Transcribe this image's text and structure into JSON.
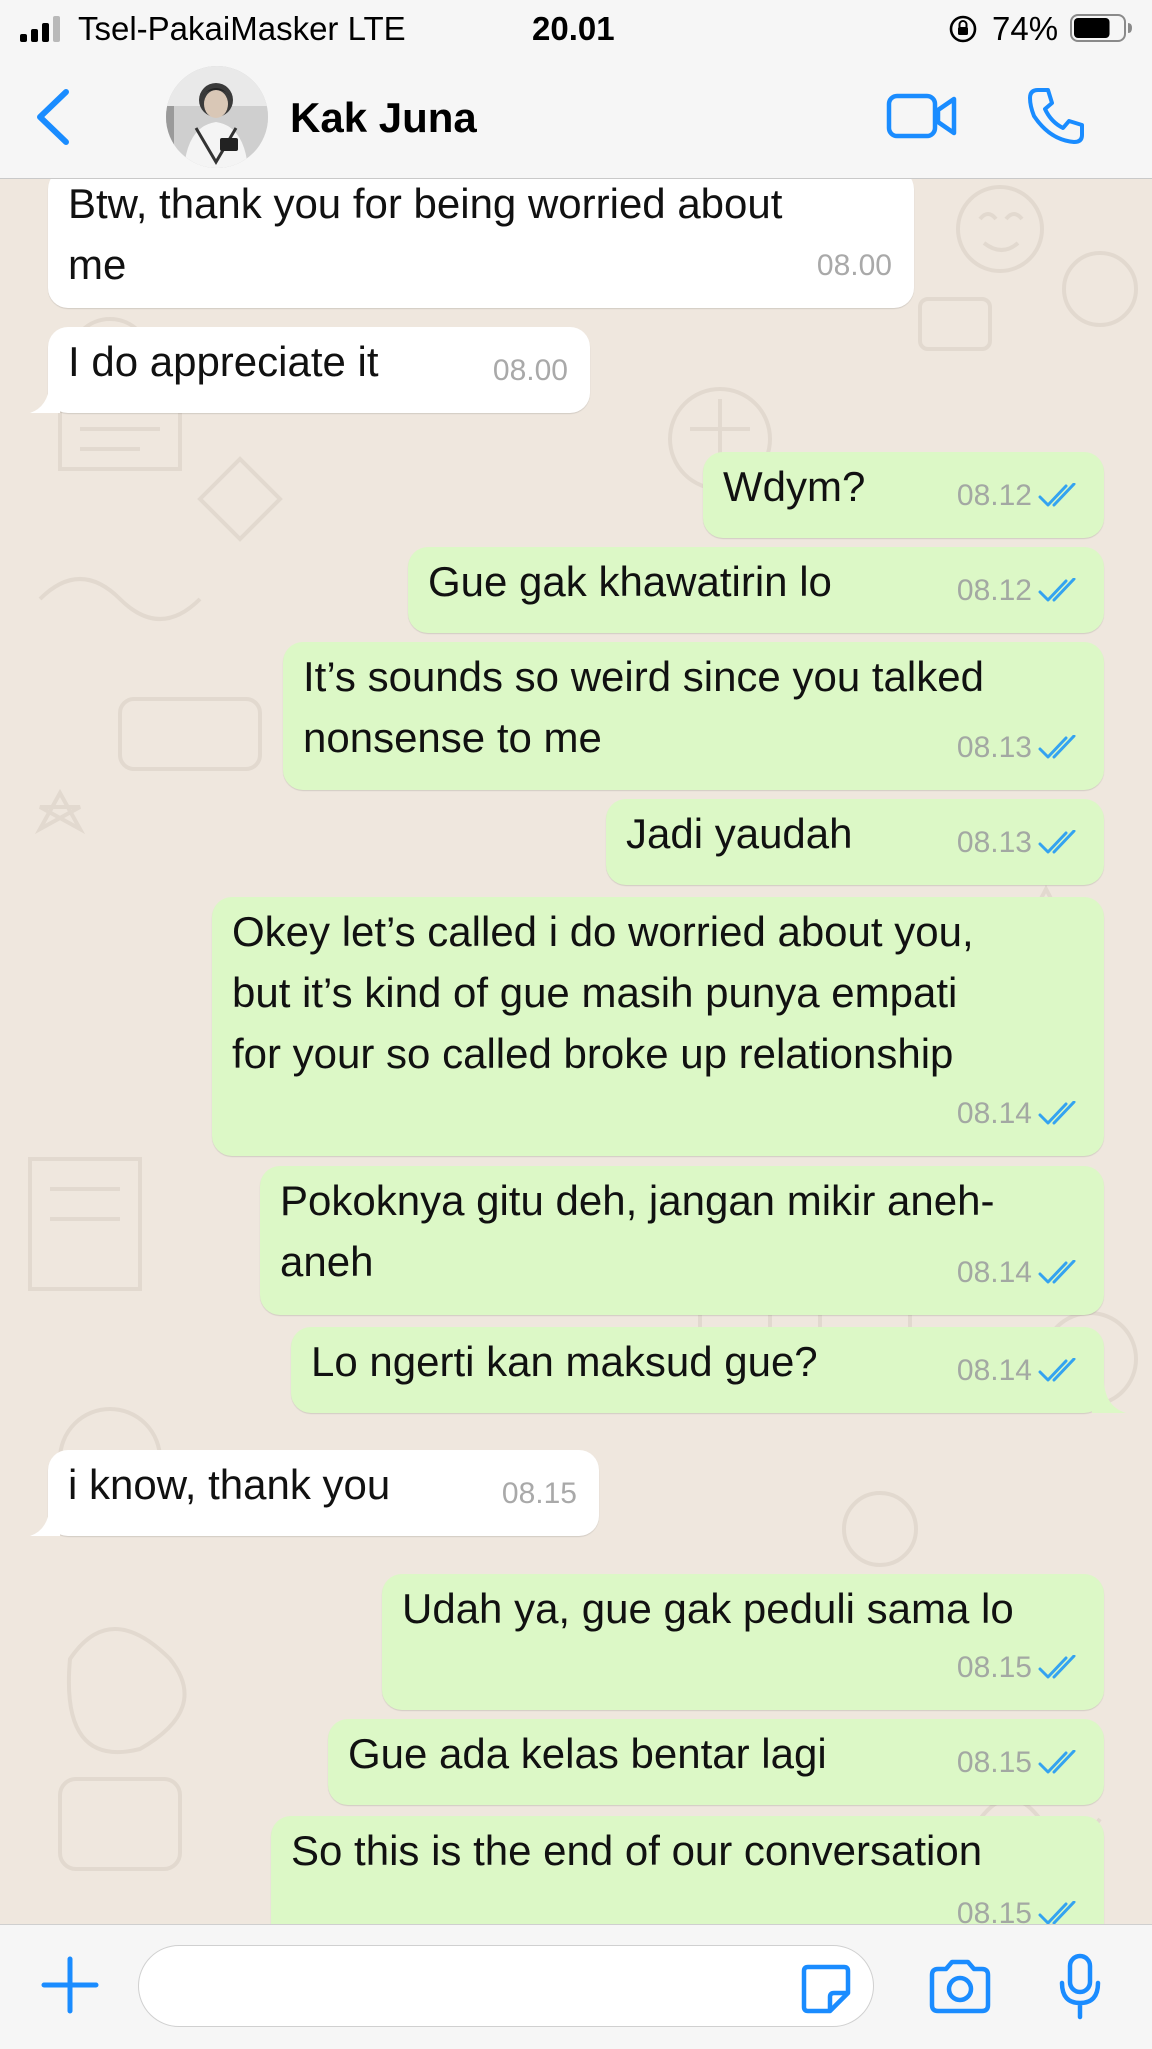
{
  "status_bar": {
    "carrier": "Tsel-PakaiMasker   LTE",
    "time": "20.01",
    "battery_percent": "74%",
    "battery_level": 0.74
  },
  "header": {
    "contact_name": "Kak Juna",
    "accent_color": "#1a8cff"
  },
  "messages": [
    {
      "dir": "in",
      "lines": [
        "Btw, thank you for being worried about",
        "me"
      ],
      "time": "08.00"
    },
    {
      "dir": "in",
      "lines": [
        "I do appreciate it"
      ],
      "time": "08.00"
    },
    {
      "dir": "out",
      "lines": [
        "Wdym?"
      ],
      "time": "08.12"
    },
    {
      "dir": "out",
      "lines": [
        "Gue gak khawatirin lo"
      ],
      "time": "08.12"
    },
    {
      "dir": "out",
      "lines": [
        "It’s sounds so weird since you talked",
        "nonsense to me"
      ],
      "time": "08.13"
    },
    {
      "dir": "out",
      "lines": [
        "Jadi yaudah"
      ],
      "time": "08.13"
    },
    {
      "dir": "out",
      "lines": [
        "Okey let’s called i do worried about you,",
        "but it’s kind of gue masih punya empati",
        "for your so called broke up relationship"
      ],
      "time": "08.14"
    },
    {
      "dir": "out",
      "lines": [
        "Pokoknya gitu deh, jangan mikir aneh-",
        "aneh"
      ],
      "time": "08.14"
    },
    {
      "dir": "out",
      "lines": [
        "Lo ngerti kan maksud gue?"
      ],
      "time": "08.14"
    },
    {
      "dir": "in",
      "lines": [
        "i know, thank you"
      ],
      "time": "08.15"
    },
    {
      "dir": "out",
      "lines": [
        "Udah ya, gue gak peduli sama lo"
      ],
      "time": "08.15"
    },
    {
      "dir": "out",
      "lines": [
        "Gue ada kelas bentar lagi"
      ],
      "time": "08.15"
    },
    {
      "dir": "out",
      "lines": [
        "So this is the end of our conversation"
      ],
      "time": "08.15"
    }
  ],
  "input": {
    "placeholder": ""
  },
  "colors": {
    "outgoing_bubble": "#dcf8c6",
    "incoming_bubble": "#ffffff",
    "read_ticks": "#34a3f0",
    "icon_blue": "#1a8cff"
  },
  "icons": [
    "back-chevron-icon",
    "video-call-icon",
    "phone-icon",
    "plus-icon",
    "sticker-icon",
    "camera-icon",
    "microphone-icon"
  ]
}
